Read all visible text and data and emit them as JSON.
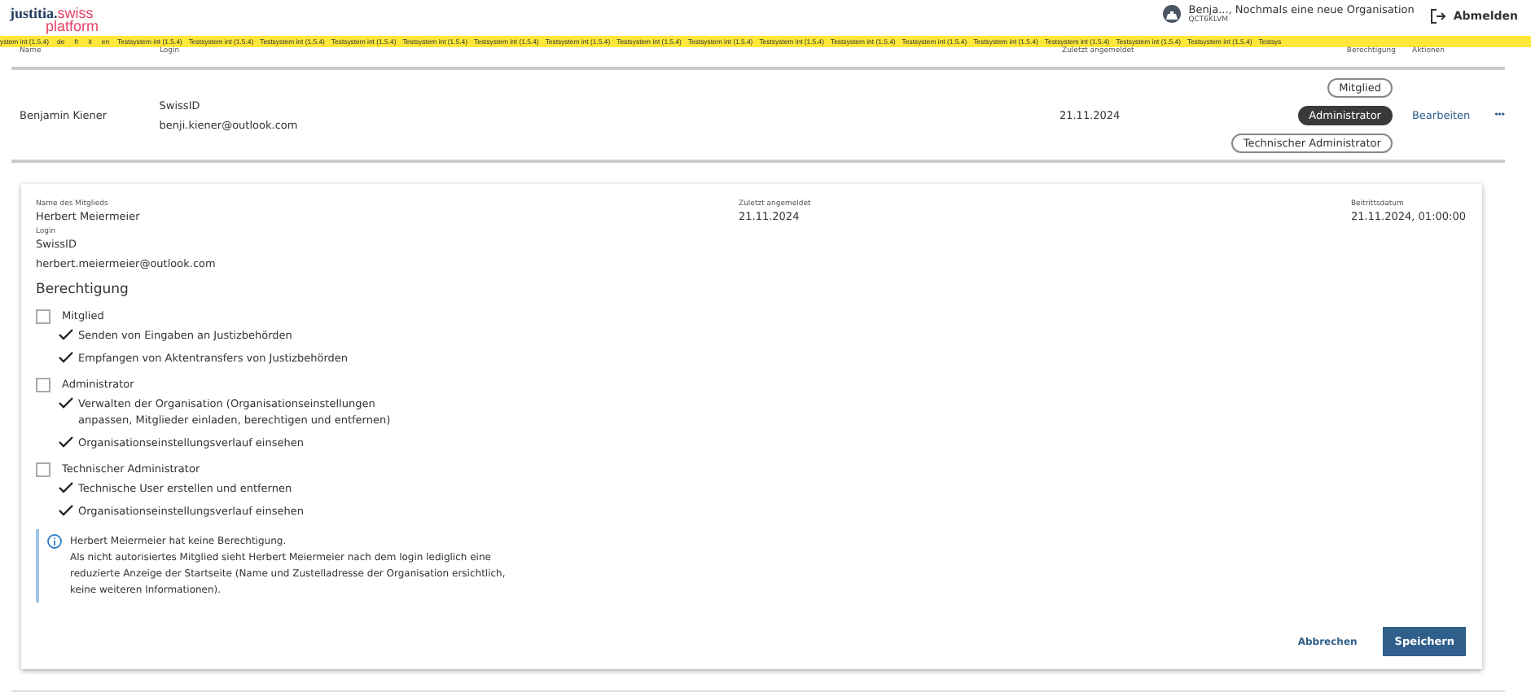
{
  "header": {
    "logo": {
      "primary": "justitia.",
      "secondary": "swiss",
      "tertiary": "platform"
    },
    "account": {
      "name": "Benja..., Nochmals eine neue Organisation",
      "code": "QCT6KLVM"
    },
    "logout": "Abmelden"
  },
  "banner": {
    "items": [
      {
        "kind": "text",
        "text": "ystem int (1.5.4)"
      },
      {
        "kind": "lang",
        "text": "de"
      },
      {
        "kind": "lang",
        "text": "fr"
      },
      {
        "kind": "lang",
        "text": "it"
      },
      {
        "kind": "lang",
        "text": "en"
      },
      {
        "kind": "text",
        "text": "Testsystem int (1.5.4)"
      },
      {
        "kind": "text",
        "text": "Testsystem int (1.5.4)"
      },
      {
        "kind": "text",
        "text": "Testsystem int (1.5.4)"
      },
      {
        "kind": "text",
        "text": "Testsystem int (1.5.4)"
      },
      {
        "kind": "text",
        "text": "Testsystem int (1.5.4)"
      },
      {
        "kind": "text",
        "text": "Testsystem int (1.5.4)"
      },
      {
        "kind": "text",
        "text": "Testsystem int (1.5.4)"
      },
      {
        "kind": "text",
        "text": "Testsystem int (1.5.4)"
      },
      {
        "kind": "text",
        "text": "Testsystem int (1.5.4)"
      },
      {
        "kind": "text",
        "text": "Testsystem int (1.5.4)"
      },
      {
        "kind": "text",
        "text": "Testsystem int (1.5.4)"
      },
      {
        "kind": "text",
        "text": "Testsystem int (1.5.4)"
      },
      {
        "kind": "text",
        "text": "Testsystem int (1.5.4)"
      },
      {
        "kind": "text",
        "text": "Testsystem int (1.5.4)"
      },
      {
        "kind": "text",
        "text": "Testsystem int (1.5.4)"
      },
      {
        "kind": "text",
        "text": "Testsystem int (1.5.4)"
      },
      {
        "kind": "text",
        "text": "Testsys"
      }
    ]
  },
  "table": {
    "columns": [
      "Name",
      "Login",
      "Zuletzt angemeldet",
      "Berechtigung",
      "Aktionen"
    ],
    "rows": [
      {
        "name": "Benjamin Kiener",
        "login_provider": "SwissID",
        "login_email": "benji.kiener@outlook.com",
        "last_login": "21.11.2024",
        "roles": [
          {
            "label": "Mitglied",
            "selected": false
          },
          {
            "label": "Administrator",
            "selected": true
          },
          {
            "label": "Technischer Administrator",
            "selected": false
          }
        ],
        "action": "Bearbeiten",
        "more": "•••"
      }
    ]
  },
  "editor": {
    "name_label": "Name des Mitglieds",
    "name": "Herbert Meiermeier",
    "last_login_label": "Zuletzt angemeldet",
    "last_login": "21.11.2024",
    "joined_label": "Beitrittsdatum",
    "joined": "21.11.2024, 01:00:00",
    "login_label": "Login",
    "login_provider": "SwissID",
    "login_email": "herbert.meiermeier@outlook.com",
    "permissions_title": "Berechtigung",
    "permissions": [
      {
        "label": "Mitglied",
        "checked": false,
        "rights": [
          "Senden von Eingaben an Justizbehörden",
          "Empfangen von Aktentransfers von Justizbehörden"
        ]
      },
      {
        "label": "Administrator",
        "checked": false,
        "rights": [
          "Verwalten der Organisation (Organisationseinstellungen anpassen, Mitglieder einladen, berechtigen und entfernen)",
          "Organisationseinstellungsverlauf einsehen"
        ]
      },
      {
        "label": "Technischer Administrator",
        "checked": false,
        "rights": [
          "Technische User erstellen und entfernen",
          "Organisationseinstellungsverlauf einsehen"
        ]
      }
    ],
    "info": {
      "title": "Herbert Meiermeier hat keine Berechtigung.",
      "text": "Als nicht autorisiertes Mitglied sieht Herbert Meiermeier nach dem login lediglich eine reduzierte Anzeige der Startseite (Name und Zustelladresse der Organisation ersichtlich, keine weiteren Informationen)."
    },
    "cancel": "Abbrechen",
    "save": "Speichern"
  }
}
